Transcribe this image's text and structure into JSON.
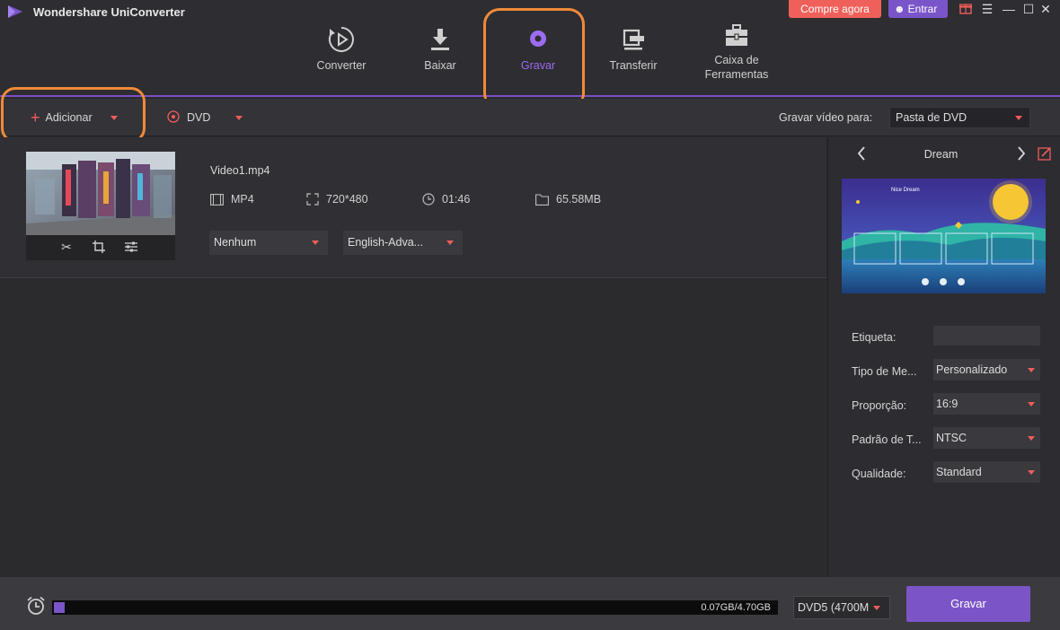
{
  "app": {
    "title": "Wondershare UniConverter"
  },
  "header": {
    "buy_label": "Compre agora",
    "login_label": "Entrar"
  },
  "nav": {
    "items": [
      {
        "label": "Converter",
        "icon": "convert-icon"
      },
      {
        "label": "Baixar",
        "icon": "download-icon"
      },
      {
        "label": "Gravar",
        "icon": "burn-disc-icon",
        "active": true
      },
      {
        "label": "Transferir",
        "icon": "transfer-icon"
      },
      {
        "label": "Caixa de",
        "label2": "Ferramentas",
        "icon": "toolbox-icon"
      }
    ]
  },
  "toolbar": {
    "add_label": "Adicionar",
    "disc_label": "DVD",
    "output_label": "Gravar vídeo para:",
    "output_value": "Pasta de DVD"
  },
  "video": {
    "filename": "Video1.mp4",
    "format": "MP4",
    "resolution": "720*480",
    "duration": "01:46",
    "size": "65.58MB",
    "subtitle": "Nenhum",
    "audio": "English-Adva..."
  },
  "template": {
    "name": "Dream",
    "preview_title": "Nice Dream",
    "fields": [
      {
        "label": "Etiqueta:",
        "value": ""
      },
      {
        "label": "Tipo de Me...",
        "value": "Personalizado"
      },
      {
        "label": "Proporção:",
        "value": "16:9"
      },
      {
        "label": "Padrão de T...",
        "value": "NTSC"
      },
      {
        "label": "Qualidade:",
        "value": "Standard"
      }
    ]
  },
  "footer": {
    "capacity_text": "0.07GB/4.70GB",
    "capacity_used_fraction": 0.015,
    "disc_type": "DVD5 (4700M",
    "burn_label": "Gravar"
  },
  "colors": {
    "accent": "#7a55c9",
    "highlight": "#f08a3a",
    "buy": "#f0605a"
  }
}
